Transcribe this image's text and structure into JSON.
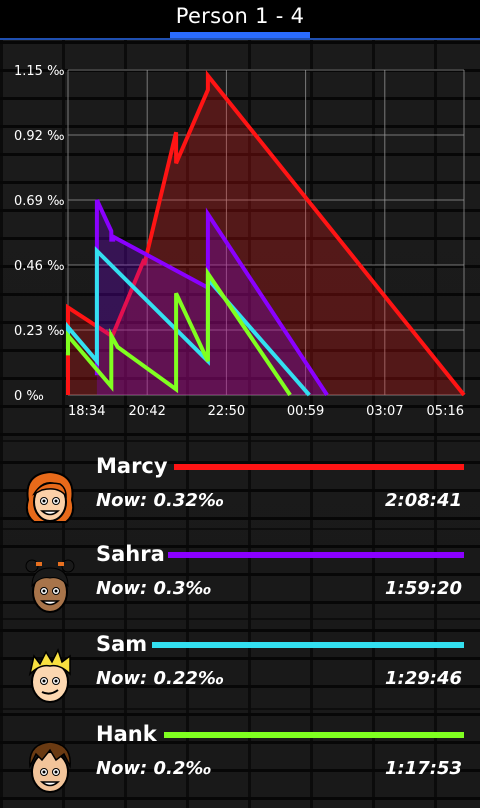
{
  "header": {
    "title": "Person 1 - 4"
  },
  "chart_data": {
    "type": "line",
    "y_ticks": [
      "1.15 ‰",
      "0.92 ‰",
      "0.69 ‰",
      "0.46 ‰",
      "0.23 ‰",
      "0 ‰"
    ],
    "x_ticks": [
      "18:34",
      "20:42",
      "22:50",
      "00:59",
      "03:07",
      "05:16"
    ],
    "ylim": [
      0,
      1.15
    ],
    "xlim_hours": [
      0,
      10.7
    ],
    "grid": true,
    "series": [
      {
        "name": "Marcy",
        "color": "#ff1414",
        "fill": true,
        "x": [
          0,
          0,
          1.17,
          1.17,
          2.06,
          2.06,
          2.92,
          2.92,
          3.78,
          3.78,
          10.7
        ],
        "y": [
          0,
          0.31,
          0.21,
          0.2,
          0.48,
          0.46,
          0.93,
          0.82,
          1.08,
          1.13,
          0
        ]
      },
      {
        "name": "Sahra",
        "color": "#8a00ff",
        "fill": true,
        "x": [
          0.78,
          0.78,
          1.17,
          1.17,
          1.22,
          1.22,
          3.78,
          3.78,
          7.0
        ],
        "y": [
          0.07,
          0.69,
          0.58,
          0.55,
          0.55,
          0.56,
          0.38,
          0.64,
          0
        ]
      },
      {
        "name": "Sam",
        "color": "#33e0f0",
        "fill": false,
        "x": [
          0,
          0,
          0.78,
          0.78,
          3.78,
          3.78,
          6.52
        ],
        "y": [
          0.18,
          0.24,
          0.12,
          0.51,
          0.12,
          0.41,
          0
        ]
      },
      {
        "name": "Hank",
        "color": "#80ff20",
        "fill": false,
        "x": [
          0,
          0,
          1.17,
          1.17,
          1.34,
          2.92,
          2.92,
          3.78,
          3.78,
          6.0
        ],
        "y": [
          0.14,
          0.21,
          0.03,
          0.21,
          0.17,
          0.02,
          0.36,
          0.12,
          0.43,
          0
        ]
      }
    ]
  },
  "people": [
    {
      "name": "Marcy",
      "now": "Now: 0.32‰",
      "time": "2:08:41",
      "color": "#ff1414",
      "avatar": "girl-orange-hair-avatar"
    },
    {
      "name": "Sahra",
      "now": "Now: 0.3‰",
      "time": "1:59:20",
      "color": "#8a00ff",
      "avatar": "girl-dark-skin-avatar"
    },
    {
      "name": "Sam",
      "now": "Now: 0.22‰",
      "time": "1:29:46",
      "color": "#33e0f0",
      "avatar": "boy-blond-avatar"
    },
    {
      "name": "Hank",
      "now": "Now: 0.2‰",
      "time": "1:17:53",
      "color": "#80ff20",
      "avatar": "boy-brown-hair-avatar"
    }
  ]
}
